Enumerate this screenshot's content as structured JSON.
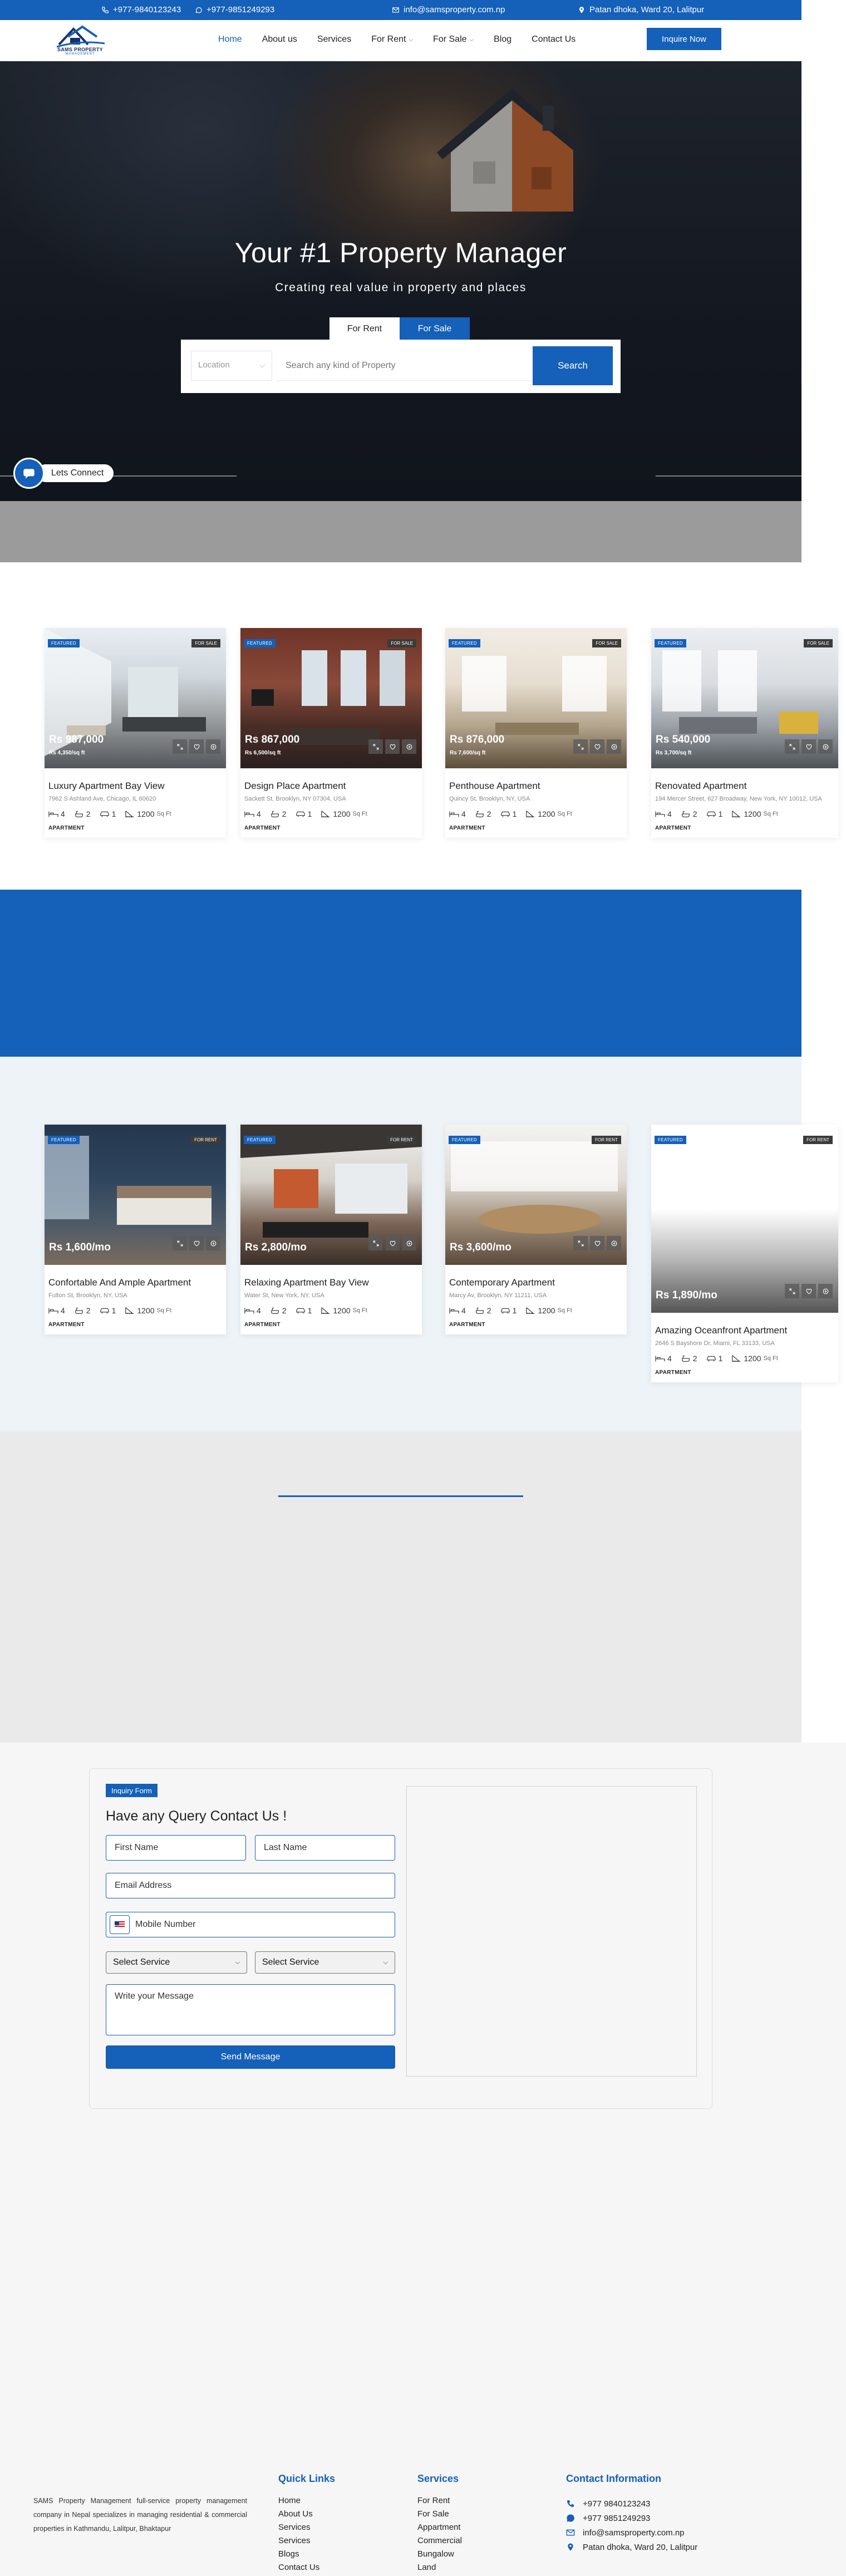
{
  "topbar": {
    "phone1": "+977-9840123243",
    "phone2": "+977-9851249293",
    "email": "info@samsproperty.com.np",
    "address": "Patan dhoka, Ward 20, Lalitpur"
  },
  "logo": {
    "brand": "SAMS PROPERTY",
    "sub": "MANAGEMENT"
  },
  "nav": {
    "items": [
      "Home",
      "About us",
      "Services",
      "For Rent",
      "For Sale",
      "Blog",
      "Contact Us"
    ],
    "cta": "Inquire Now"
  },
  "hero": {
    "title": "Your #1 Property Manager",
    "tagline": "Creating real value in property and places",
    "tab_rent": "For Rent",
    "tab_sale": "For Sale",
    "location_placeholder": "Location",
    "search_placeholder": "Search any kind of Property",
    "search_button": "Search"
  },
  "connect": {
    "label": "Lets Connect"
  },
  "sale": [
    {
      "badge": "FEATURED",
      "status": "FOR SALE",
      "price": "Rs 987,000",
      "ppsf": "Rs 4,350/sq ft",
      "name": "Luxury Apartment Bay View",
      "address": "7962 S Ashland Ave, Chicago, IL 60620",
      "beds": "4",
      "baths": "2",
      "garage": "1",
      "area": "1200",
      "unit": "Sq Ft",
      "type": "APARTMENT"
    },
    {
      "badge": "FEATURED",
      "status": "FOR SALE",
      "price": "Rs 867,000",
      "ppsf": "Rs 6,500/sq ft",
      "name": "Design Place Apartment",
      "address": "Sackett St, Brooklyn, NY 07304, USA",
      "beds": "4",
      "baths": "2",
      "garage": "1",
      "area": "1200",
      "unit": "Sq Ft",
      "type": "APARTMENT"
    },
    {
      "badge": "FEATURED",
      "status": "FOR SALE",
      "price": "Rs 876,000",
      "ppsf": "Rs 7,600/sq ft",
      "name": "Penthouse Apartment",
      "address": "Quincy St, Brooklyn, NY, USA",
      "beds": "4",
      "baths": "2",
      "garage": "1",
      "area": "1200",
      "unit": "Sq Ft",
      "type": "APARTMENT"
    },
    {
      "badge": "FEATURED",
      "status": "FOR SALE",
      "price": "Rs 540,000",
      "ppsf": "Rs 3,700/sq ft",
      "name": "Renovated Apartment",
      "address": "194 Mercer Street, 627 Broadway, New York, NY 10012, USA",
      "beds": "4",
      "baths": "2",
      "garage": "1",
      "area": "1200",
      "unit": "Sq Ft",
      "type": "APARTMENT"
    }
  ],
  "rent": [
    {
      "badge": "FEATURED",
      "status": "FOR RENT",
      "price": "Rs 1,600/mo",
      "name": "Confortable And Ample Apartment",
      "address": "Fulton St, Brooklyn, NY, USA",
      "beds": "4",
      "baths": "2",
      "garage": "1",
      "area": "1200",
      "unit": "Sq Ft",
      "type": "APARTMENT"
    },
    {
      "badge": "FEATURED",
      "status": "FOR RENT",
      "price": "Rs 2,800/mo",
      "name": "Relaxing Apartment Bay View",
      "address": "Water St, New York, NY, USA",
      "beds": "4",
      "baths": "2",
      "garage": "1",
      "area": "1200",
      "unit": "Sq Ft",
      "type": "APARTMENT"
    },
    {
      "badge": "FEATURED",
      "status": "FOR RENT",
      "price": "Rs 3,600/mo",
      "name": "Contemporary Apartment",
      "address": "Marcy Av, Brooklyn, NY 11211, USA",
      "beds": "4",
      "baths": "2",
      "garage": "1",
      "area": "1200",
      "unit": "Sq Ft",
      "type": "APARTMENT"
    },
    {
      "badge": "FEATURED",
      "status": "FOR RENT",
      "price": "Rs 1,890/mo",
      "name": "Amazing Oceanfront Apartment",
      "address": "2646 S Bayshore Dr, Miami, FL 33133, USA",
      "beds": "4",
      "baths": "2",
      "garage": "1",
      "area": "1200",
      "unit": "Sq Ft",
      "type": "APARTMENT"
    }
  ],
  "form": {
    "tag": "Inquiry Form",
    "title": "Have any Query Contact Us !",
    "first_name": "First Name",
    "last_name": "Last Name",
    "email": "Email Address",
    "mobile": "Mobile Number",
    "service1": "Select Service",
    "service2": "Select Service",
    "message": "Write your Message",
    "send": "Send Message"
  },
  "footer": {
    "about": "SAMS Property Management full-service property management company in Nepal specializes in managing residential & commercial properties in Kathmandu, Lalitpur, Bhaktapur",
    "quick_title": "Quick Links",
    "quick": [
      "Home",
      "About Us",
      "Services",
      "Services",
      "Blogs",
      "Contact Us"
    ],
    "services_title": "Services",
    "services": [
      "For Rent",
      "For Sale",
      "Appartment",
      "Commercial",
      "Bungalow",
      "Land"
    ],
    "contact_title": "Contact Information",
    "contact_phone1": "+977 9840123243",
    "contact_phone2": "+977 9851249293",
    "contact_email": "info@samsproperty.com.np",
    "contact_address": "Patan dhoka, Ward 20, Lalitpur"
  },
  "colors": {
    "brand": "#1560b8",
    "dark": "#222222"
  }
}
